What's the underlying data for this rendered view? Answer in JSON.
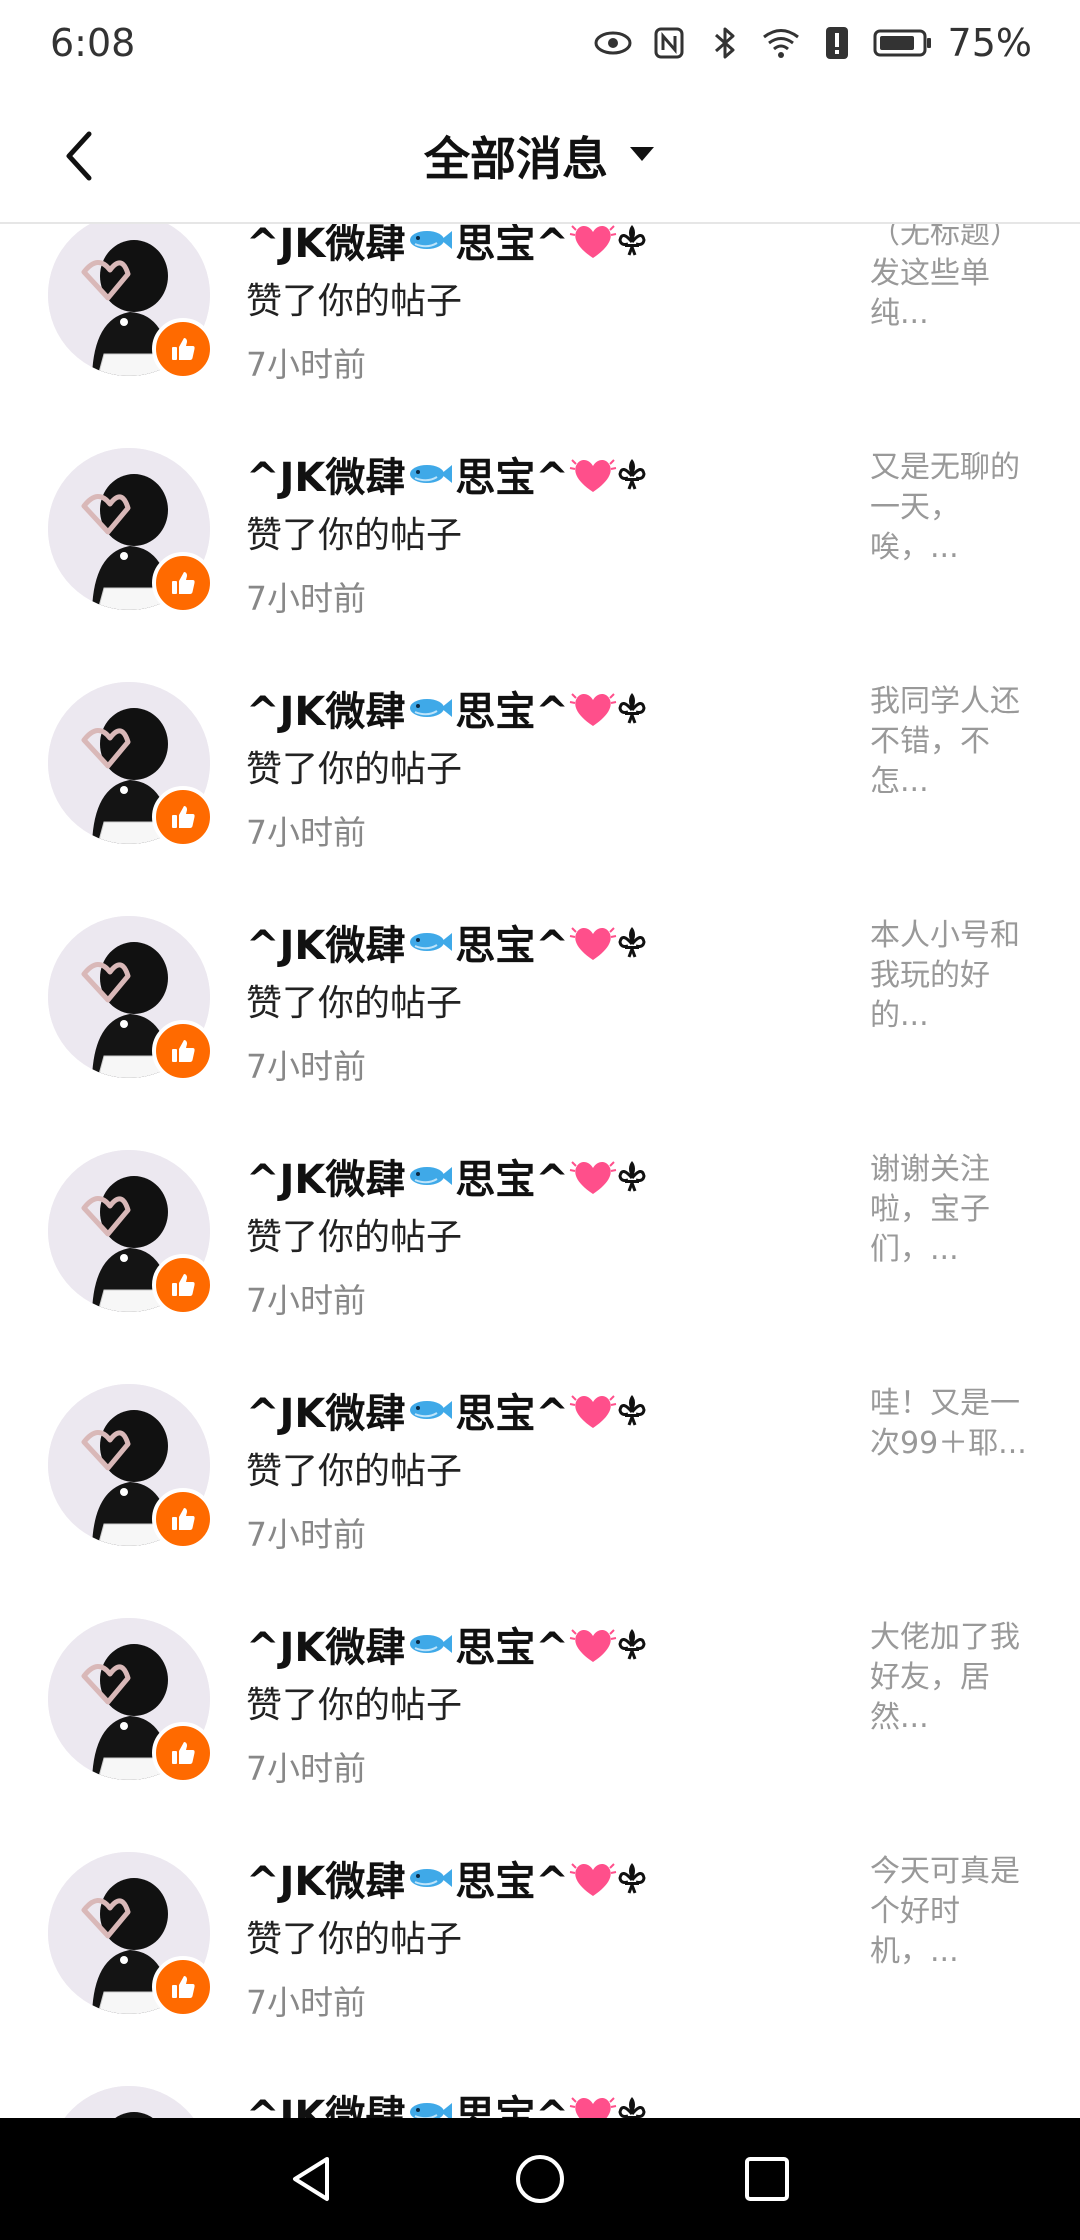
{
  "status_bar": {
    "time": "6:08",
    "battery": "75%",
    "icons": [
      "eye-icon",
      "nfc-icon",
      "bluetooth-icon",
      "wifi-icon",
      "alert-icon",
      "battery-icon"
    ]
  },
  "header": {
    "title": "全部消息",
    "back_icon": "chevron-left-icon",
    "dropdown_icon": "caret-down-icon"
  },
  "accent_color": "#ff6a00",
  "notifications": [
    {
      "user": "^JK微肆",
      "user_suffix": "思宝^",
      "action": "赞了你的帖子",
      "time": "7小时前",
      "preview": "（无标题）发这些单纯..."
    },
    {
      "user": "^JK微肆",
      "user_suffix": "思宝^",
      "action": "赞了你的帖子",
      "time": "7小时前",
      "preview": "又是无聊的一天，唉，..."
    },
    {
      "user": "^JK微肆",
      "user_suffix": "思宝^",
      "action": "赞了你的帖子",
      "time": "7小时前",
      "preview": "我同学人还不错，不怎..."
    },
    {
      "user": "^JK微肆",
      "user_suffix": "思宝^",
      "action": "赞了你的帖子",
      "time": "7小时前",
      "preview": "本人小号和我玩的好的..."
    },
    {
      "user": "^JK微肆",
      "user_suffix": "思宝^",
      "action": "赞了你的帖子",
      "time": "7小时前",
      "preview": "谢谢关注啦，宝子们，..."
    },
    {
      "user": "^JK微肆",
      "user_suffix": "思宝^",
      "action": "赞了你的帖子",
      "time": "7小时前",
      "preview": "哇！又是一次99＋耶..."
    },
    {
      "user": "^JK微肆",
      "user_suffix": "思宝^",
      "action": "赞了你的帖子",
      "time": "7小时前",
      "preview": "大佬加了我好友，居然..."
    },
    {
      "user": "^JK微肆",
      "user_suffix": "思宝^",
      "action": "赞了你的帖子",
      "time": "7小时前",
      "preview": "今天可真是个好时机，..."
    },
    {
      "user": "^JK微肆",
      "user_suffix": "思宝^",
      "action": "",
      "time": "",
      "preview": ""
    }
  ],
  "nav": {
    "back": "nav-back-icon",
    "home": "nav-home-icon",
    "recents": "nav-recents-icon"
  }
}
